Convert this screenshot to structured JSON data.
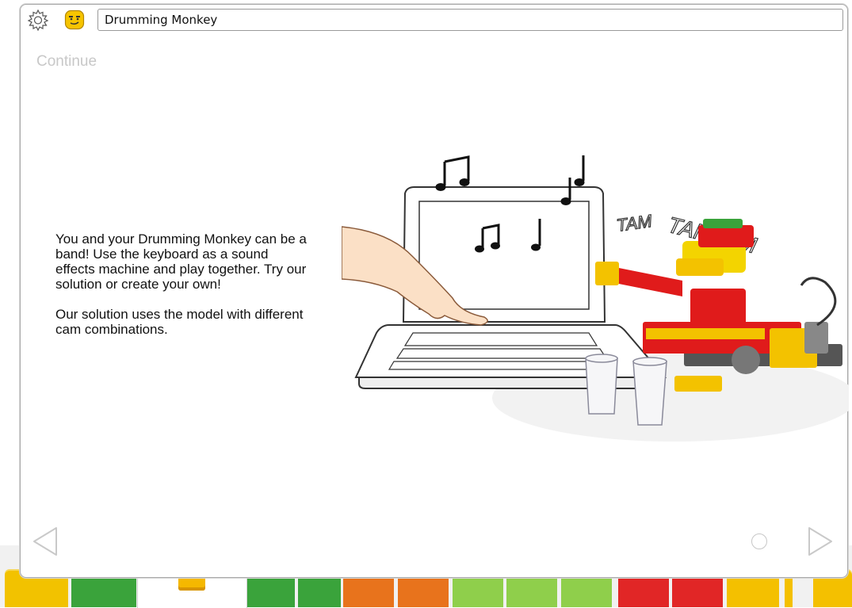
{
  "title_field": {
    "value": "Drumming Monkey"
  },
  "continue_label": "Continue",
  "body": {
    "paragraphs": [
      "You and your Drumming Monkey can be a band! Use the keyboard as a sound effects machine and play together. Try our solution or create your own!",
      "Our solution uses the model with different cam combinations."
    ]
  },
  "illustration": {
    "sound_words": [
      "TAMTAM",
      "TAM"
    ]
  },
  "icons": {
    "settings": "gear-icon",
    "character": "face-icon",
    "prev": "left-triangle-icon",
    "next": "right-triangle-icon"
  },
  "pagination": {
    "current_page": 1,
    "total_pages": 1
  },
  "colors": {
    "palette": [
      "#f2c200",
      "#3aa33b",
      "#3aa33b",
      "#3aa33b",
      "#3aa33b",
      "#e8731c",
      "#e8731c",
      "#8fcf4b",
      "#8fcf4b",
      "#8fcf4b",
      "#e12626",
      "#e12626",
      "#f4c000",
      "#f4c000"
    ],
    "nav_arrow": "#cfcfcf",
    "continue_text": "#c8c8c8"
  }
}
